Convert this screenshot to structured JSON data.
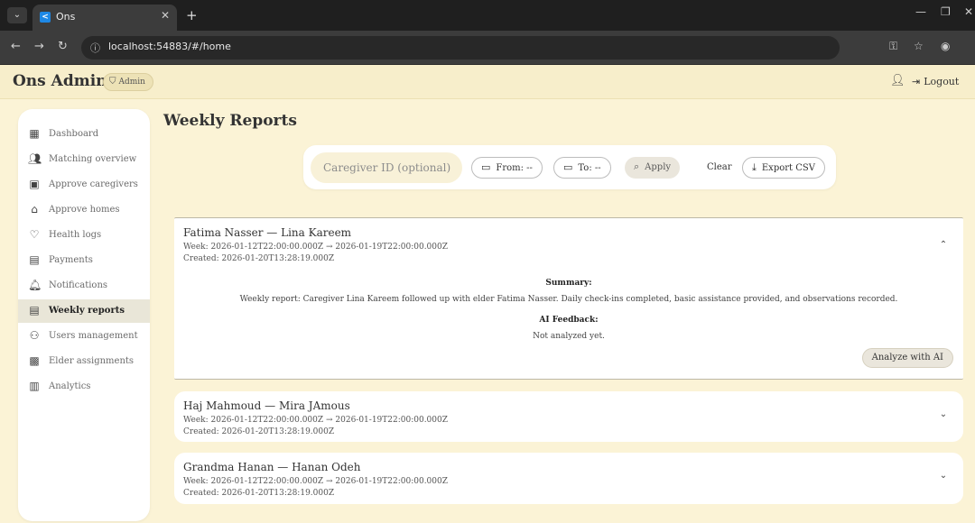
{
  "browser": {
    "tab_title": "Ons",
    "tab_favicon_letter": "<",
    "url": "localhost:54883/#/home"
  },
  "appbar": {
    "brand": "Ons Admin",
    "role_chip": "Admin",
    "logout_label": "Logout"
  },
  "sidebar": {
    "items": [
      {
        "label": "Dashboard",
        "icon": "dashboard-icon"
      },
      {
        "label": "Matching overview",
        "icon": "group-icon"
      },
      {
        "label": "Approve caregivers",
        "icon": "badge-icon"
      },
      {
        "label": "Approve homes",
        "icon": "home-icon"
      },
      {
        "label": "Health logs",
        "icon": "heart-icon"
      },
      {
        "label": "Payments",
        "icon": "payment-icon"
      },
      {
        "label": "Notifications",
        "icon": "bell-icon"
      },
      {
        "label": "Weekly reports",
        "icon": "report-icon",
        "active": true
      },
      {
        "label": "Users management",
        "icon": "users-icon"
      },
      {
        "label": "Elder assignments",
        "icon": "assignment-icon"
      },
      {
        "label": "Analytics",
        "icon": "analytics-icon"
      }
    ]
  },
  "main": {
    "page_title": "Weekly Reports",
    "filters": {
      "caregiver_placeholder": "Caregiver ID (optional)",
      "caregiver_value": "",
      "from_label": "From: --",
      "to_label": "To: --",
      "apply_label": "Apply",
      "clear_label": "Clear",
      "export_label": "Export CSV"
    },
    "reports": [
      {
        "names": "Fatima Nasser — Lina Kareem",
        "week": "Week: 2026-01-12T22:00:00.000Z → 2026-01-19T22:00:00.000Z",
        "created": "Created: 2026-01-20T13:28:19.000Z",
        "expanded": true,
        "summary_heading": "Summary:",
        "summary": "Weekly report: Caregiver Lina Kareem followed up with elder Fatima Nasser. Daily check-ins completed, basic assistance provided, and observations recorded.",
        "feedback_heading": "AI Feedback:",
        "feedback": "Not analyzed yet.",
        "analyze_label": "Analyze with AI"
      },
      {
        "names": "Haj Mahmoud — Mira JAmous",
        "week": "Week: 2026-01-12T22:00:00.000Z → 2026-01-19T22:00:00.000Z",
        "created": "Created: 2026-01-20T13:28:19.000Z",
        "expanded": false
      },
      {
        "names": "Grandma Hanan — Hanan Odeh",
        "week": "Week: 2026-01-12T22:00:00.000Z → 2026-01-19T22:00:00.000Z",
        "created": "Created: 2026-01-20T13:28:19.000Z",
        "expanded": false
      }
    ]
  }
}
